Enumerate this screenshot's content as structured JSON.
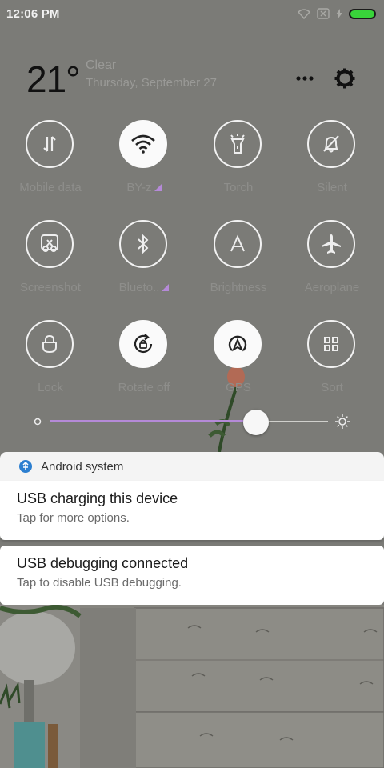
{
  "status_bar": {
    "time": "12:06 PM",
    "battery_color": "#39d33a"
  },
  "weather": {
    "temperature": "21°",
    "condition": "Clear",
    "date": "Thursday, September 27"
  },
  "toggles": [
    {
      "label": "Mobile data",
      "icon": "mobile-data-icon",
      "active": false,
      "has_menu": false
    },
    {
      "label": "BY-z",
      "icon": "wifi-icon",
      "active": true,
      "has_menu": true
    },
    {
      "label": "Torch",
      "icon": "torch-icon",
      "active": false,
      "has_menu": false
    },
    {
      "label": "Silent",
      "icon": "bell-off-icon",
      "active": false,
      "has_menu": false
    },
    {
      "label": "Screenshot",
      "icon": "screenshot-icon",
      "active": false,
      "has_menu": false
    },
    {
      "label": "Blueto..",
      "icon": "bluetooth-icon",
      "active": false,
      "has_menu": true
    },
    {
      "label": "Brightness",
      "icon": "brightness-icon",
      "active": false,
      "has_menu": false
    },
    {
      "label": "Aeroplane",
      "icon": "airplane-icon",
      "active": false,
      "has_menu": false
    },
    {
      "label": "Lock",
      "icon": "lock-icon",
      "active": false,
      "has_menu": false
    },
    {
      "label": "Rotate off",
      "icon": "rotate-lock-icon",
      "active": true,
      "has_menu": false
    },
    {
      "label": "GPS",
      "icon": "gps-icon",
      "active": true,
      "has_menu": false
    },
    {
      "label": "Sort",
      "icon": "sort-grid-icon",
      "active": false,
      "has_menu": false
    }
  ],
  "brightness": {
    "level": 0.74,
    "accent_color": "#b58ad8"
  },
  "notifications": {
    "app_name": "Android system",
    "items": [
      {
        "title": "USB charging this device",
        "subtitle": "Tap for more options."
      },
      {
        "title": "USB debugging connected",
        "subtitle": "Tap to disable USB debugging."
      }
    ]
  }
}
